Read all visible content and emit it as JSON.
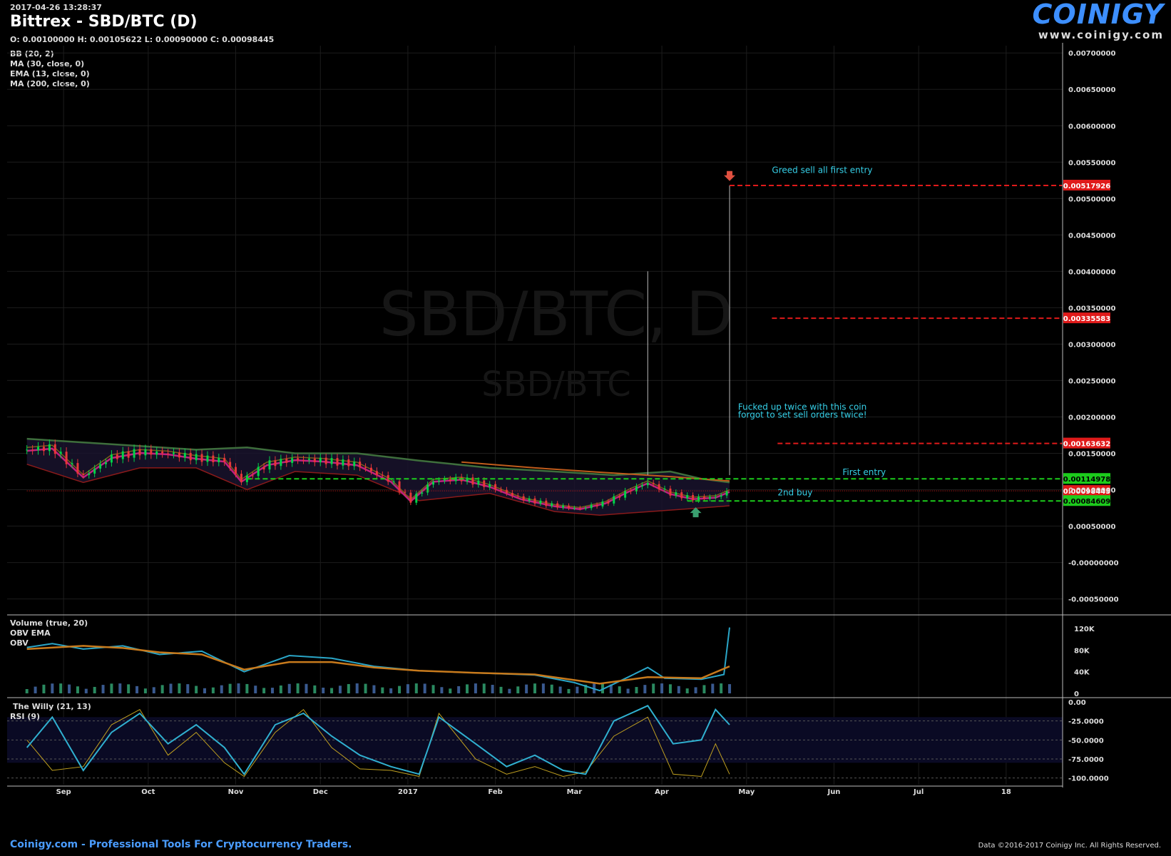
{
  "header": {
    "timestamp": "2017-04-26 13:28:37",
    "title": "Bittrex - SBD/BTC (D)",
    "ohlc": "O: 0.00100000 H: 0.00105622 L: 0.00090000 C: 0.00098445",
    "indicators": [
      "BB (20, 2)",
      "MA (30, close, 0)",
      "EMA (13, close, 0)",
      "MA (200, close, 0)"
    ]
  },
  "brand": {
    "name": "COINIGY",
    "url": "www.coinigy.com"
  },
  "watermark": {
    "main": "SBD/BTC, D",
    "sub": "SBD/BTC"
  },
  "colors": {
    "background": "#000000",
    "grid": "#1c1c1c",
    "up": "#00d44a",
    "down": "#e8363a",
    "red_level": "#e01a1a",
    "green_level": "#1ccc1c",
    "annotation": "#36d0e8",
    "bb_upper": "#3e6e3c",
    "bb_lower": "#8a1a1a",
    "ma30": "#b04020",
    "ema13": "#7a5c1c",
    "ma200": "#c05c1c",
    "obv": "#2aa6c8",
    "obv_ema": "#c87a1c",
    "willy": "#30b0d0",
    "rsi": "#c0a020",
    "accent": "#3d8fff"
  },
  "chart_data": [
    {
      "type": "line",
      "panel": "price",
      "xaxis_labels": [
        "Sep",
        "Oct",
        "Nov",
        "Dec",
        "2017",
        "Feb",
        "Mar",
        "Apr",
        "May",
        "Jun",
        "Jul",
        "18"
      ],
      "ylim": [
        -0.0007,
        0.0071
      ],
      "ytick_labels": [
        "0.00700000",
        "0.00650000",
        "0.00600000",
        "0.00550000",
        "0.00500000",
        "0.00450000",
        "0.00400000",
        "0.00350000",
        "0.00300000",
        "0.00250000",
        "0.00200000",
        "0.00150000",
        "0.00100000",
        "0.00050000",
        "-0.00000000",
        "-0.00050000"
      ],
      "ytick_values": [
        0.007,
        0.0065,
        0.006,
        0.0055,
        0.005,
        0.0045,
        0.004,
        0.0035,
        0.003,
        0.0025,
        0.002,
        0.0015,
        0.001,
        0.0005,
        0.0,
        -0.0005
      ],
      "series": [
        {
          "role": "price",
          "x": [
            "2016-08-19",
            "2016-08-28",
            "2016-09-08",
            "2016-09-18",
            "2016-09-28",
            "2016-10-08",
            "2016-10-18",
            "2016-10-28",
            "2016-11-03",
            "2016-11-12",
            "2016-11-22",
            "2016-12-02",
            "2016-12-14",
            "2016-12-26",
            "2017-01-02",
            "2017-01-10",
            "2017-01-20",
            "2017-01-30",
            "2017-02-10",
            "2017-02-22",
            "2017-03-03",
            "2017-03-12",
            "2017-03-20",
            "2017-03-27",
            "2017-04-04",
            "2017-04-12",
            "2017-04-20",
            "2017-04-25"
          ],
          "y": [
            0.00155,
            0.00158,
            0.00118,
            0.00145,
            0.00152,
            0.0015,
            0.00144,
            0.0014,
            0.00112,
            0.00135,
            0.00142,
            0.0014,
            0.00135,
            0.00112,
            0.00085,
            0.00112,
            0.00115,
            0.00105,
            0.00088,
            0.00078,
            0.00074,
            0.00082,
            0.00098,
            0.0011,
            0.00095,
            0.00088,
            0.0009,
            0.00098
          ]
        },
        {
          "role": "bb_upper",
          "x": [
            "2016-08-19",
            "2016-09-08",
            "2016-09-28",
            "2016-10-18",
            "2016-11-05",
            "2016-11-22",
            "2016-12-14",
            "2017-01-05",
            "2017-01-30",
            "2017-02-22",
            "2017-03-15",
            "2017-04-04",
            "2017-04-15",
            "2017-04-25"
          ],
          "y": [
            0.0017,
            0.00165,
            0.0016,
            0.00155,
            0.00158,
            0.0015,
            0.0015,
            0.0014,
            0.0013,
            0.00125,
            0.0012,
            0.00125,
            0.00115,
            0.0011
          ]
        },
        {
          "role": "bb_lower",
          "x": [
            "2016-08-19",
            "2016-09-08",
            "2016-09-28",
            "2016-10-18",
            "2016-11-05",
            "2016-11-22",
            "2016-12-14",
            "2017-01-05",
            "2017-01-30",
            "2017-02-22",
            "2017-03-10",
            "2017-04-04",
            "2017-04-15",
            "2017-04-25"
          ],
          "y": [
            0.00135,
            0.0011,
            0.0013,
            0.0013,
            0.001,
            0.00125,
            0.0012,
            0.00085,
            0.00095,
            0.0007,
            0.00065,
            0.00072,
            0.00075,
            0.00078
          ]
        },
        {
          "role": "ma200",
          "x": [
            "2017-01-20",
            "2017-02-15",
            "2017-03-10",
            "2017-04-04",
            "2017-04-25"
          ],
          "y": [
            0.00138,
            0.0013,
            0.00124,
            0.00118,
            0.00112
          ]
        }
      ],
      "spikes": [
        {
          "x": "2017-03-27",
          "y": 0.004
        },
        {
          "x": "2017-04-25",
          "y": 0.00517926
        }
      ],
      "price_levels": [
        {
          "label": "0.00517926",
          "value": 0.00517926,
          "color": "red",
          "from": "2017-04-25"
        },
        {
          "label": "0.00335583",
          "value": 0.00335583,
          "color": "red",
          "from": "2017-05-10"
        },
        {
          "label": "0.00163632",
          "value": 0.00163632,
          "color": "red",
          "from": "2017-05-12"
        },
        {
          "label": "0.00114978",
          "value": 0.00114978,
          "color": "green",
          "from": "2016-11-05"
        },
        {
          "label": "0.00098445",
          "value": 0.00098445,
          "color": "red",
          "from": "2016-08-19",
          "dotted": true
        },
        {
          "label": "0.00084609",
          "value": 0.00084609,
          "color": "green",
          "from": "2017-04-10"
        }
      ],
      "annotations": [
        {
          "text": "Greed sell all first entry",
          "x": "2017-05-10",
          "y": 0.00535
        },
        {
          "text": "Fucked up twice with this coin",
          "x": "2017-04-28",
          "y": 0.0021
        },
        {
          "text": "forgot to set sell orders twice!",
          "x": "2017-04-28",
          "y": 0.00199
        },
        {
          "text": "First entry",
          "x": "2017-06-04",
          "y": 0.0012
        },
        {
          "text": "2nd buy",
          "x": "2017-05-12",
          "y": 0.00092
        }
      ],
      "markers": [
        {
          "kind": "sell-arrow",
          "x": "2017-04-25",
          "y": 0.0053
        },
        {
          "kind": "buy-arrow",
          "x": "2017-04-13",
          "y": 0.00072
        }
      ]
    },
    {
      "type": "line",
      "panel": "volume",
      "title": "Volume (true, 20)",
      "legend": [
        "OBV EMA",
        "OBV"
      ],
      "ylim": [
        0,
        140000
      ],
      "ytick_labels": [
        "120K",
        "80K",
        "40K",
        "0"
      ],
      "ytick_values": [
        120000,
        80000,
        40000,
        0
      ],
      "series": [
        {
          "role": "obv",
          "x": [
            "2016-08-19",
            "2016-08-28",
            "2016-09-08",
            "2016-09-22",
            "2016-10-05",
            "2016-10-20",
            "2016-11-04",
            "2016-11-20",
            "2016-12-05",
            "2016-12-20",
            "2017-01-05",
            "2017-01-25",
            "2017-02-15",
            "2017-03-01",
            "2017-03-10",
            "2017-03-20",
            "2017-03-27",
            "2017-04-02",
            "2017-04-15",
            "2017-04-23",
            "2017-04-25"
          ],
          "y": [
            85000,
            92000,
            82000,
            88000,
            72000,
            78000,
            40000,
            70000,
            65000,
            50000,
            42000,
            38000,
            34000,
            20000,
            5000,
            30000,
            48000,
            28000,
            26000,
            35000,
            122000
          ]
        },
        {
          "role": "obv_ema",
          "x": [
            "2016-08-19",
            "2016-09-08",
            "2016-09-22",
            "2016-10-05",
            "2016-10-20",
            "2016-11-04",
            "2016-11-20",
            "2016-12-05",
            "2016-12-20",
            "2017-01-05",
            "2017-01-25",
            "2017-02-15",
            "2017-03-10",
            "2017-03-27",
            "2017-04-15",
            "2017-04-25"
          ],
          "y": [
            82000,
            88000,
            84000,
            76000,
            72000,
            44000,
            58000,
            58000,
            48000,
            42000,
            38000,
            35000,
            18000,
            30000,
            28000,
            50000
          ]
        }
      ]
    },
    {
      "type": "line",
      "panel": "oscillator",
      "title": "The Willy (21, 13)",
      "legend": [
        "RSI (9)"
      ],
      "ylim": [
        -105,
        0
      ],
      "ytick_labels": [
        "0.00",
        "-25.0000",
        "-50.0000",
        "-75.0000",
        "-100.0000"
      ],
      "ytick_values": [
        0,
        -25,
        -50,
        -75,
        -100
      ],
      "series": [
        {
          "role": "willy",
          "x": [
            "2016-08-19",
            "2016-08-28",
            "2016-09-08",
            "2016-09-18",
            "2016-09-28",
            "2016-10-08",
            "2016-10-18",
            "2016-10-28",
            "2016-11-04",
            "2016-11-15",
            "2016-11-25",
            "2016-12-05",
            "2016-12-15",
            "2016-12-26",
            "2017-01-05",
            "2017-01-12",
            "2017-01-25",
            "2017-02-05",
            "2017-02-15",
            "2017-02-25",
            "2017-03-05",
            "2017-03-15",
            "2017-03-27",
            "2017-04-05",
            "2017-04-15",
            "2017-04-20",
            "2017-04-25"
          ],
          "y": [
            -60,
            -20,
            -90,
            -40,
            -15,
            -55,
            -30,
            -60,
            -95,
            -30,
            -15,
            -45,
            -70,
            -85,
            -95,
            -20,
            -55,
            -85,
            -70,
            -90,
            -95,
            -25,
            -5,
            -55,
            -50,
            -10,
            -30
          ]
        },
        {
          "role": "rsi",
          "x": [
            "2016-08-19",
            "2016-08-28",
            "2016-09-08",
            "2016-09-18",
            "2016-09-28",
            "2016-10-08",
            "2016-10-18",
            "2016-10-28",
            "2016-11-04",
            "2016-11-15",
            "2016-11-25",
            "2016-12-05",
            "2016-12-15",
            "2016-12-26",
            "2017-01-05",
            "2017-01-12",
            "2017-01-25",
            "2017-02-05",
            "2017-02-15",
            "2017-02-25",
            "2017-03-05",
            "2017-03-15",
            "2017-03-27",
            "2017-04-05",
            "2017-04-15",
            "2017-04-20",
            "2017-04-25"
          ],
          "y": [
            -50,
            -90,
            -85,
            -30,
            -10,
            -70,
            -40,
            -80,
            -98,
            -40,
            -10,
            -60,
            -88,
            -90,
            -98,
            -15,
            -75,
            -95,
            -85,
            -98,
            -92,
            -45,
            -20,
            -95,
            -98,
            -55,
            -95
          ]
        }
      ]
    }
  ],
  "footer": {
    "left": "Coinigy.com - Professional Tools For Cryptocurrency Traders.",
    "right": "Data ©2016-2017 Coinigy Inc. All Rights Reserved."
  }
}
